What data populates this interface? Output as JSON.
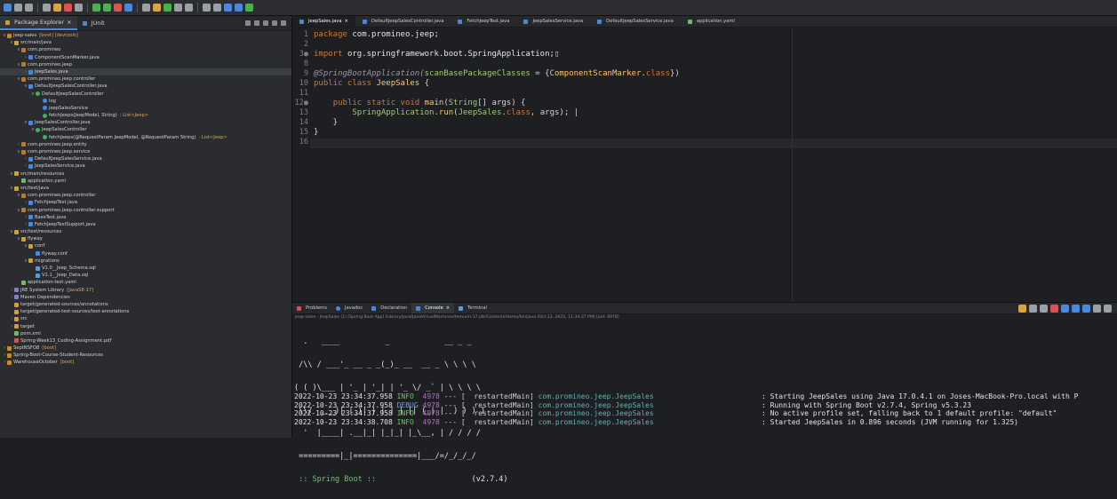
{
  "left_panel": {
    "tabs": [
      {
        "label": "Package Explorer"
      },
      {
        "label": "JUnit"
      }
    ],
    "tree": [
      {
        "label": "jeep-sales",
        "extra": "[boot] [devtools]",
        "icon": "proj",
        "indent": 0,
        "arrow": "v"
      },
      {
        "label": "src/main/java",
        "icon": "folder",
        "indent": 1,
        "arrow": "v"
      },
      {
        "label": "com.promineo",
        "icon": "pkg",
        "indent": 2,
        "arrow": "v"
      },
      {
        "label": "ComponentScanMarker.java",
        "icon": "java",
        "indent": 3,
        "arrow": ">"
      },
      {
        "label": "com.promineo.jeep",
        "icon": "pkg",
        "indent": 2,
        "arrow": "v"
      },
      {
        "label": "JeepSales.java",
        "icon": "java",
        "indent": 3,
        "arrow": ">",
        "selected": true
      },
      {
        "label": "com.promineo.jeep.controller",
        "icon": "pkg",
        "indent": 2,
        "arrow": "v"
      },
      {
        "label": "DefaultJeepSalesController.java",
        "icon": "java",
        "indent": 3,
        "arrow": "v"
      },
      {
        "label": "DefaultJeepSalesController",
        "icon": "class",
        "indent": 4,
        "arrow": "v"
      },
      {
        "label": "log",
        "icon": "field",
        "indent": 5,
        "arrow": ""
      },
      {
        "label": "jeepSalesService",
        "icon": "field",
        "indent": 5,
        "arrow": ""
      },
      {
        "label": "fetchJeeps(JeepModel, String)",
        "extra": ": List<Jeep>",
        "icon": "class",
        "indent": 5,
        "arrow": ""
      },
      {
        "label": "JeepSalesController.java",
        "icon": "java",
        "indent": 3,
        "arrow": "v"
      },
      {
        "label": "JeepSalesController",
        "icon": "class",
        "indent": 4,
        "arrow": "v"
      },
      {
        "label": "fetchJeeps(@RequestParam JeepModel, @RequestParam String)",
        "extra": ": List<Jeep>",
        "icon": "class",
        "indent": 5,
        "arrow": ""
      },
      {
        "label": "com.promineo.jeep.entity",
        "icon": "pkg",
        "indent": 2,
        "arrow": ">"
      },
      {
        "label": "com.promineo.jeep.service",
        "icon": "pkg",
        "indent": 2,
        "arrow": "v"
      },
      {
        "label": "DefaultJeepSalesService.java",
        "icon": "java",
        "indent": 3,
        "arrow": ">"
      },
      {
        "label": "JeepSalesService.java",
        "icon": "java",
        "indent": 3,
        "arrow": ">"
      },
      {
        "label": "src/main/resources",
        "icon": "folder",
        "indent": 1,
        "arrow": "v"
      },
      {
        "label": "application.yaml",
        "icon": "yml",
        "indent": 2,
        "arrow": ""
      },
      {
        "label": "src/test/java",
        "icon": "folder",
        "indent": 1,
        "arrow": "v"
      },
      {
        "label": "com.promineo.jeep.controller",
        "icon": "pkg",
        "indent": 2,
        "arrow": "v"
      },
      {
        "label": "FetchJeepTest.java",
        "icon": "java",
        "indent": 3,
        "arrow": ">"
      },
      {
        "label": "com.promineo.jeep.controller.support",
        "icon": "pkg",
        "indent": 2,
        "arrow": "v"
      },
      {
        "label": "BaseTest.java",
        "icon": "java",
        "indent": 3,
        "arrow": ">"
      },
      {
        "label": "FetchJeepTestSupport.java",
        "icon": "java",
        "indent": 3,
        "arrow": ">"
      },
      {
        "label": "src/test/resources",
        "icon": "folder",
        "indent": 1,
        "arrow": "v"
      },
      {
        "label": "flyway",
        "icon": "folder",
        "indent": 2,
        "arrow": "v"
      },
      {
        "label": "conf",
        "icon": "folder",
        "indent": 3,
        "arrow": "v"
      },
      {
        "label": "flyway.conf",
        "icon": "java",
        "indent": 4,
        "arrow": ""
      },
      {
        "label": "migrations",
        "icon": "folder",
        "indent": 3,
        "arrow": "v"
      },
      {
        "label": "V1.0__Jeep_Schema.sql",
        "icon": "sql",
        "indent": 4,
        "arrow": ""
      },
      {
        "label": "V1.1__Jeep_Data.sql",
        "icon": "sql",
        "indent": 4,
        "arrow": ""
      },
      {
        "label": "application-test.yaml",
        "icon": "yml",
        "indent": 2,
        "arrow": ""
      },
      {
        "label": "JRE System Library",
        "extra": "[JavaSE-17]",
        "icon": "lib",
        "indent": 1,
        "arrow": ">"
      },
      {
        "label": "Maven Dependencies",
        "icon": "lib",
        "indent": 1,
        "arrow": ">"
      },
      {
        "label": "target/generated-sources/annotations",
        "icon": "folder",
        "indent": 1,
        "arrow": ""
      },
      {
        "label": "target/generated-test-sources/test-annotations",
        "icon": "folder",
        "indent": 1,
        "arrow": ""
      },
      {
        "label": "src",
        "icon": "folder",
        "indent": 1,
        "arrow": ">"
      },
      {
        "label": "target",
        "icon": "folder",
        "indent": 1,
        "arrow": ">"
      },
      {
        "label": "pom.xml",
        "icon": "yml",
        "indent": 1,
        "arrow": ""
      },
      {
        "label": "Spring-Week13_Coding-Assignment.pdf",
        "icon": "pdf",
        "indent": 1,
        "arrow": ""
      },
      {
        "label": "SeptNSFO8",
        "extra": "[boot]",
        "icon": "proj",
        "indent": 0,
        "arrow": ">"
      },
      {
        "label": "Spring-Boot-Course-Student-Resources",
        "icon": "proj",
        "indent": 0,
        "arrow": ">"
      },
      {
        "label": "WarehouseOctober",
        "extra": "[boot]",
        "icon": "proj",
        "indent": 0,
        "arrow": ">"
      }
    ]
  },
  "editor": {
    "tabs": [
      {
        "label": "JeepSales.java",
        "active": true
      },
      {
        "label": "DefaultJeepSalesController.java"
      },
      {
        "label": "FetchJeepTest.java"
      },
      {
        "label": "JeepSalesService.java"
      },
      {
        "label": "DefaultJeepSalesService.java"
      },
      {
        "label": "application.yaml"
      }
    ],
    "lines": [
      {
        "n": "1",
        "parts": [
          [
            "kw",
            "package "
          ],
          [
            "pkg",
            "com.promineo.jeep;"
          ]
        ]
      },
      {
        "n": "2",
        "parts": []
      },
      {
        "n": "3●",
        "parts": [
          [
            "kw",
            "import "
          ],
          [
            "pkg",
            "org.springframework.boot.SpringApplication;"
          ],
          [
            "plain",
            "▯"
          ]
        ]
      },
      {
        "n": "8",
        "parts": []
      },
      {
        "n": "9",
        "parts": [
          [
            "ann",
            "@SpringBootApplication("
          ],
          [
            "cls",
            "scanBasePackageClasses"
          ],
          [
            "plain",
            " = {"
          ],
          [
            "fn",
            "ComponentScanMarker"
          ],
          [
            "plain",
            "."
          ],
          [
            "kw",
            "class"
          ],
          [
            "plain",
            "})"
          ]
        ]
      },
      {
        "n": "10",
        "parts": [
          [
            "kw",
            "public class "
          ],
          [
            "fn",
            "JeepSales"
          ],
          [
            "plain",
            " {"
          ]
        ]
      },
      {
        "n": "11",
        "parts": []
      },
      {
        "n": "12●",
        "parts": [
          [
            "plain",
            "    "
          ],
          [
            "kw",
            "public static void "
          ],
          [
            "fn",
            "main"
          ],
          [
            "plain",
            "("
          ],
          [
            "cls",
            "String"
          ],
          [
            "plain",
            "[] args) {"
          ]
        ]
      },
      {
        "n": "13",
        "parts": [
          [
            "plain",
            "        "
          ],
          [
            "cls",
            "SpringApplication"
          ],
          [
            "plain",
            "."
          ],
          [
            "fn",
            "run"
          ],
          [
            "plain",
            "("
          ],
          [
            "cls",
            "JeepSales"
          ],
          [
            "plain",
            "."
          ],
          [
            "kw",
            "class"
          ],
          [
            "plain",
            ", args); |"
          ]
        ]
      },
      {
        "n": "14",
        "parts": [
          [
            "plain",
            "    }"
          ]
        ]
      },
      {
        "n": "15",
        "parts": [
          [
            "plain",
            "}"
          ]
        ]
      },
      {
        "n": "16",
        "parts": []
      }
    ]
  },
  "console": {
    "tabs": [
      {
        "label": "Problems"
      },
      {
        "label": "Javadoc"
      },
      {
        "label": "Declaration"
      },
      {
        "label": "Console",
        "active": true
      },
      {
        "label": "Terminal"
      }
    ],
    "info": "jeep-sales - JeepSales (1) [Spring Boot App] /Library/Java/JavaVirtualMachines/temurin-17.jdk/Contents/Home/bin/java (Oct 23, 2022, 11:34:37 PM) [pid: 4978]",
    "banner": [
      "  .   ____          _            __ _ _",
      " /\\\\ / ___'_ __ _ _(_)_ __  __ _ \\ \\ \\ \\",
      "( ( )\\___ | '_ | '_| | '_ \\/ _` | \\ \\ \\ \\",
      " \\\\/  ___)| |_)| | | | | || (_| |  ) ) ) )",
      "  '  |____| .__|_| |_|_| |_\\__, | / / / /",
      " =========|_|==============|___/=/_/_/_/"
    ],
    "boot_label": " :: Spring Boot ::",
    "boot_version": "(v2.7.4)",
    "logs": [
      {
        "ts": "2022-10-23 23:34:37.958",
        "level": "INFO",
        "pid": "4978",
        "sep": "---",
        "thread": "[  restartedMain]",
        "cat": "com.promineo.jeep.JeepSales",
        "msg": ": Starting JeepSales using Java 17.0.4.1 on Joses-MacBook-Pro.local with P"
      },
      {
        "ts": "2022-10-23 23:34:37.958",
        "level": "DEBUG",
        "pid": "4978",
        "sep": "---",
        "thread": "[  restartedMain]",
        "cat": "com.promineo.jeep.JeepSales",
        "msg": ": Running with Spring Boot v2.7.4, Spring v5.3.23"
      },
      {
        "ts": "2022-10-23 23:34:37.958",
        "level": "INFO",
        "pid": "4978",
        "sep": "---",
        "thread": "[  restartedMain]",
        "cat": "com.promineo.jeep.JeepSales",
        "msg": ": No active profile set, falling back to 1 default profile: \"default\""
      },
      {
        "ts": "2022-10-23 23:34:38.708",
        "level": "INFO",
        "pid": "4978",
        "sep": "---",
        "thread": "[  restartedMain]",
        "cat": "com.promineo.jeep.JeepSales",
        "msg": ": Started JeepSales in 0.896 seconds (JVM running for 1.325)"
      }
    ]
  }
}
